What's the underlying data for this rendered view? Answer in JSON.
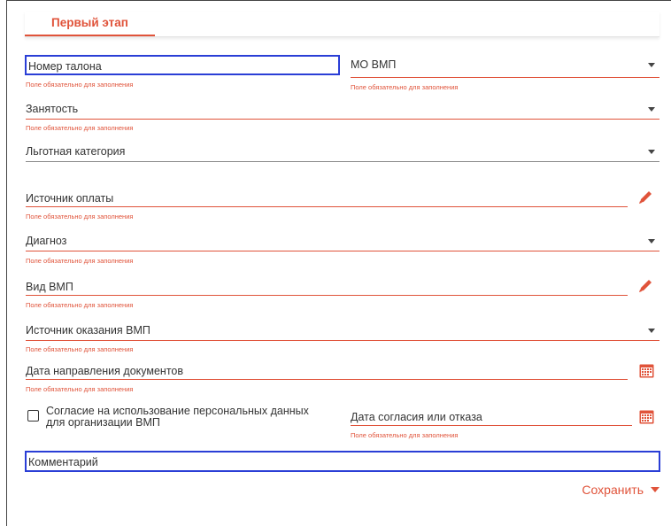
{
  "tab": {
    "label": "Первый этап"
  },
  "fields": {
    "ticket_number": {
      "label": "Номер талона",
      "error": "Поле обязательно для заполнения"
    },
    "mo_vmp": {
      "label": "МО ВМП",
      "error": "Поле обязательно для заполнения"
    },
    "employment": {
      "label": "Занятость",
      "error": "Поле обязательно для заполнения"
    },
    "preferential_category": {
      "label": "Льготная категория"
    },
    "payment_source": {
      "label": "Источник оплаты",
      "error": "Поле обязательно для заполнения"
    },
    "diagnosis": {
      "label": "Диагноз",
      "error": "Поле обязательно для заполнения"
    },
    "vmp_type": {
      "label": "Вид ВМП",
      "error": "Поле обязательно для заполнения"
    },
    "vmp_provision_source": {
      "label": "Источник оказания ВМП",
      "error": "Поле обязательно для заполнения"
    },
    "documents_direction_date": {
      "label": "Дата направления документов",
      "error": "Поле обязательно для заполнения"
    },
    "consent": {
      "line1": "Согласие на использование персональных данных",
      "line2": "для организации ВМП",
      "checked": false
    },
    "consent_date": {
      "label": "Дата согласия или отказа",
      "error": "Поле обязательно для заполнения"
    },
    "comment": {
      "label": "Комментарий"
    }
  },
  "actions": {
    "save_label": "Сохранить"
  },
  "colors": {
    "accent": "#e0533a",
    "focus_border": "#2a3ed6"
  },
  "icons": {
    "edit": "pencil-icon",
    "date": "calendar-icon",
    "dropdown": "caret-down-icon"
  }
}
